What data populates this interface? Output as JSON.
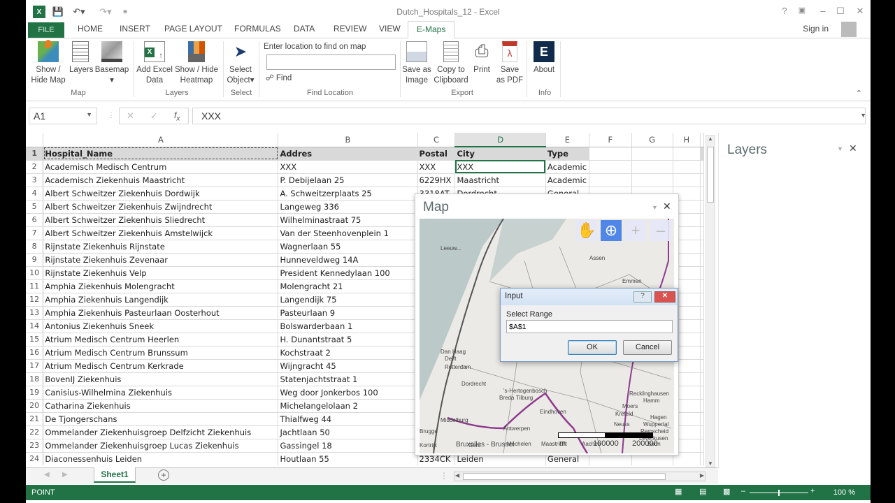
{
  "window": {
    "title": "Dutch_Hospitals_12 - Excel",
    "controls": [
      "?",
      "ribbon-display-options",
      "minimize",
      "maximize",
      "close"
    ]
  },
  "quick_access": {
    "icons": [
      "excel-logo",
      "save",
      "undo",
      "redo",
      "customize"
    ]
  },
  "tabs": {
    "file": "FILE",
    "items": [
      "HOME",
      "INSERT",
      "PAGE LAYOUT",
      "FORMULAS",
      "DATA",
      "REVIEW",
      "VIEW"
    ],
    "active": "E-Maps",
    "sign_in": "Sign in"
  },
  "ribbon": {
    "groups": {
      "map": "Map",
      "layers": "Layers",
      "select": "Select",
      "find_location": "Find Location",
      "export": "Export",
      "info": "Info"
    },
    "buttons": {
      "show_hide_map": "Show /\nHide Map",
      "layers": "Layers",
      "basemap": "Basemap",
      "add_excel_data": "Add Excel\nData",
      "show_hide_heatmap": "Show / Hide\nHeatmap",
      "select_object": "Select\nObject",
      "save_as_image": "Save as\nImage",
      "copy_to_clipboard": "Copy to\nClipboard",
      "print": "Print",
      "save_as_pdf": "Save\nas PDF",
      "about": "About"
    },
    "find": {
      "label": "Enter location to find on map",
      "value": "",
      "button": "Find"
    }
  },
  "formula_bar": {
    "name_box": "A1",
    "formula": "XXX"
  },
  "sheet": {
    "columns": [
      "A",
      "B",
      "C",
      "D",
      "E",
      "F",
      "G",
      "H"
    ],
    "selected_column": "D",
    "header_row": [
      "Hospital_Name",
      "Addres",
      "Postal",
      "City",
      "Type"
    ],
    "rows": [
      [
        "Academisch Medisch Centrum",
        "XXX",
        "XXX",
        "XXX",
        "Academic"
      ],
      [
        "Academisch Ziekenhuis Maastricht",
        "P. Debijelaan 25",
        "6229HX",
        "Maastricht",
        "Academic"
      ],
      [
        "Albert Schweitzer Ziekenhuis Dordwijk",
        "A. Schweitzerplaats 25",
        "3318AT",
        "Dordrecht",
        "General"
      ],
      [
        "Albert Schweitzer Ziekenhuis Zwijndrecht",
        "Langeweg 336",
        "",
        "",
        ""
      ],
      [
        "Albert Schweitzer Ziekenhuis Sliedrecht",
        "Wilhelminastraat 75",
        "",
        "",
        ""
      ],
      [
        "Albert Schweitzer Ziekenhuis Amstelwijck",
        "Van der Steenhovenplein 1",
        "",
        "",
        ""
      ],
      [
        "Rijnstate Ziekenhuis Rijnstate",
        "Wagnerlaan 55",
        "",
        "",
        ""
      ],
      [
        "Rijnstate Ziekenhuis Zevenaar",
        "Hunneveldweg 14A",
        "",
        "",
        ""
      ],
      [
        "Rijnstate Ziekenhuis Velp",
        "President Kennedylaan 100",
        "",
        "",
        ""
      ],
      [
        "Amphia Ziekenhuis Molengracht",
        "Molengracht 21",
        "",
        "",
        ""
      ],
      [
        "Amphia Ziekenhuis Langendijk",
        "Langendijk 75",
        "",
        "",
        ""
      ],
      [
        "Amphia Ziekenhuis Pasteurlaan Oosterhout",
        "Pasteurlaan 9",
        "",
        "",
        ""
      ],
      [
        "Antonius Ziekenhuis Sneek",
        "Bolswarderbaan 1",
        "",
        "",
        ""
      ],
      [
        "Atrium Medisch Centrum Heerlen",
        "H. Dunantstraat 5",
        "",
        "",
        ""
      ],
      [
        "Atrium Medisch Centrum Brunssum",
        "Kochstraat 2",
        "",
        "",
        ""
      ],
      [
        "Atrium Medisch Centrum Kerkrade",
        "Wijngracht 45",
        "",
        "",
        ""
      ],
      [
        "BovenIJ Ziekenhuis",
        "Statenjachtstraat 1",
        "",
        "",
        ""
      ],
      [
        "Canisius-Wilhelmina Ziekenhuis",
        "Weg door Jonkerbos 100",
        "",
        "",
        ""
      ],
      [
        "Catharina Ziekenhuis",
        "Michelangelolaan 2",
        "",
        "",
        ""
      ],
      [
        "De Tjongerschans",
        "Thialfweg 44",
        "",
        "",
        ""
      ],
      [
        "Ommelander Ziekenhuisgroep Delfzicht Ziekenhuis",
        "Jachtlaan 50",
        "",
        "",
        ""
      ],
      [
        "Ommelander Ziekenhuisgroep Lucas Ziekenhuis",
        "Gassingel 18",
        "",
        "",
        ""
      ],
      [
        "Diaconessenhuis Leiden",
        "Houtlaan 55",
        "2334CK",
        "Leiden",
        "General"
      ]
    ]
  },
  "sheet_tabs": {
    "active": "Sheet1"
  },
  "status_bar": {
    "mode": "POINT",
    "zoom": "100 %"
  },
  "layers_pane": {
    "title": "Layers"
  },
  "map_pane": {
    "title": "Map",
    "tools": [
      "pan",
      "zoom-box",
      "zoom-in",
      "zoom-out"
    ],
    "active_tool": "zoom-box",
    "place_labels": [
      "Leeuw...",
      "Assen",
      "Emmen",
      "Dan Haag",
      "Delft",
      "Rotterdam",
      "Dordrecht",
      "'s-Hertogenbosch",
      "Breda",
      "Tilburg",
      "Eindhoven",
      "Middelburg",
      "Brugge",
      "Antwerpen",
      "Gent",
      "Mechelen",
      "Bruxelles - Brussel",
      "Kortrijk",
      "Maastricht",
      "Aachen",
      "Recklinghausen",
      "Hamm",
      "Moers",
      "Krefeld",
      "Hagen",
      "Wuppertal",
      "Neuss",
      "Remscheid",
      "Leverkusen",
      "Bonn"
    ],
    "scale_labels": [
      "m",
      "100000",
      "200000"
    ]
  },
  "dialog": {
    "title": "Input",
    "label": "Select Range",
    "value": "$A$1",
    "ok": "OK",
    "cancel": "Cancel"
  }
}
